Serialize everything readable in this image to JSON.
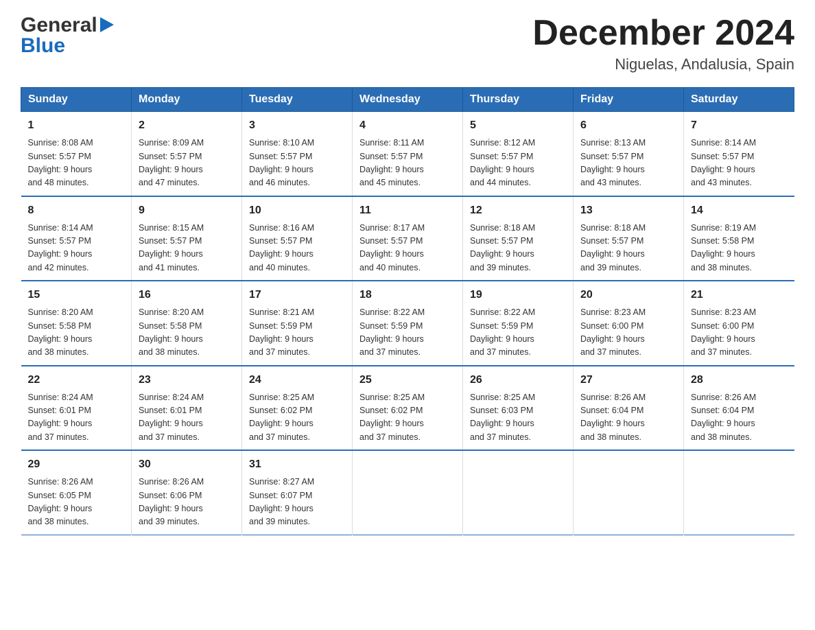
{
  "header": {
    "logo_general": "General",
    "logo_blue": "Blue",
    "month_title": "December 2024",
    "location": "Niguelas, Andalusia, Spain"
  },
  "columns": [
    "Sunday",
    "Monday",
    "Tuesday",
    "Wednesday",
    "Thursday",
    "Friday",
    "Saturday"
  ],
  "weeks": [
    [
      {
        "day": "1",
        "sunrise": "8:08 AM",
        "sunset": "5:57 PM",
        "daylight": "9 hours and 48 minutes."
      },
      {
        "day": "2",
        "sunrise": "8:09 AM",
        "sunset": "5:57 PM",
        "daylight": "9 hours and 47 minutes."
      },
      {
        "day": "3",
        "sunrise": "8:10 AM",
        "sunset": "5:57 PM",
        "daylight": "9 hours and 46 minutes."
      },
      {
        "day": "4",
        "sunrise": "8:11 AM",
        "sunset": "5:57 PM",
        "daylight": "9 hours and 45 minutes."
      },
      {
        "day": "5",
        "sunrise": "8:12 AM",
        "sunset": "5:57 PM",
        "daylight": "9 hours and 44 minutes."
      },
      {
        "day": "6",
        "sunrise": "8:13 AM",
        "sunset": "5:57 PM",
        "daylight": "9 hours and 43 minutes."
      },
      {
        "day": "7",
        "sunrise": "8:14 AM",
        "sunset": "5:57 PM",
        "daylight": "9 hours and 43 minutes."
      }
    ],
    [
      {
        "day": "8",
        "sunrise": "8:14 AM",
        "sunset": "5:57 PM",
        "daylight": "9 hours and 42 minutes."
      },
      {
        "day": "9",
        "sunrise": "8:15 AM",
        "sunset": "5:57 PM",
        "daylight": "9 hours and 41 minutes."
      },
      {
        "day": "10",
        "sunrise": "8:16 AM",
        "sunset": "5:57 PM",
        "daylight": "9 hours and 40 minutes."
      },
      {
        "day": "11",
        "sunrise": "8:17 AM",
        "sunset": "5:57 PM",
        "daylight": "9 hours and 40 minutes."
      },
      {
        "day": "12",
        "sunrise": "8:18 AM",
        "sunset": "5:57 PM",
        "daylight": "9 hours and 39 minutes."
      },
      {
        "day": "13",
        "sunrise": "8:18 AM",
        "sunset": "5:57 PM",
        "daylight": "9 hours and 39 minutes."
      },
      {
        "day": "14",
        "sunrise": "8:19 AM",
        "sunset": "5:58 PM",
        "daylight": "9 hours and 38 minutes."
      }
    ],
    [
      {
        "day": "15",
        "sunrise": "8:20 AM",
        "sunset": "5:58 PM",
        "daylight": "9 hours and 38 minutes."
      },
      {
        "day": "16",
        "sunrise": "8:20 AM",
        "sunset": "5:58 PM",
        "daylight": "9 hours and 38 minutes."
      },
      {
        "day": "17",
        "sunrise": "8:21 AM",
        "sunset": "5:59 PM",
        "daylight": "9 hours and 37 minutes."
      },
      {
        "day": "18",
        "sunrise": "8:22 AM",
        "sunset": "5:59 PM",
        "daylight": "9 hours and 37 minutes."
      },
      {
        "day": "19",
        "sunrise": "8:22 AM",
        "sunset": "5:59 PM",
        "daylight": "9 hours and 37 minutes."
      },
      {
        "day": "20",
        "sunrise": "8:23 AM",
        "sunset": "6:00 PM",
        "daylight": "9 hours and 37 minutes."
      },
      {
        "day": "21",
        "sunrise": "8:23 AM",
        "sunset": "6:00 PM",
        "daylight": "9 hours and 37 minutes."
      }
    ],
    [
      {
        "day": "22",
        "sunrise": "8:24 AM",
        "sunset": "6:01 PM",
        "daylight": "9 hours and 37 minutes."
      },
      {
        "day": "23",
        "sunrise": "8:24 AM",
        "sunset": "6:01 PM",
        "daylight": "9 hours and 37 minutes."
      },
      {
        "day": "24",
        "sunrise": "8:25 AM",
        "sunset": "6:02 PM",
        "daylight": "9 hours and 37 minutes."
      },
      {
        "day": "25",
        "sunrise": "8:25 AM",
        "sunset": "6:02 PM",
        "daylight": "9 hours and 37 minutes."
      },
      {
        "day": "26",
        "sunrise": "8:25 AM",
        "sunset": "6:03 PM",
        "daylight": "9 hours and 37 minutes."
      },
      {
        "day": "27",
        "sunrise": "8:26 AM",
        "sunset": "6:04 PM",
        "daylight": "9 hours and 38 minutes."
      },
      {
        "day": "28",
        "sunrise": "8:26 AM",
        "sunset": "6:04 PM",
        "daylight": "9 hours and 38 minutes."
      }
    ],
    [
      {
        "day": "29",
        "sunrise": "8:26 AM",
        "sunset": "6:05 PM",
        "daylight": "9 hours and 38 minutes."
      },
      {
        "day": "30",
        "sunrise": "8:26 AM",
        "sunset": "6:06 PM",
        "daylight": "9 hours and 39 minutes."
      },
      {
        "day": "31",
        "sunrise": "8:27 AM",
        "sunset": "6:07 PM",
        "daylight": "9 hours and 39 minutes."
      },
      null,
      null,
      null,
      null
    ]
  ],
  "labels": {
    "sunrise": "Sunrise:",
    "sunset": "Sunset:",
    "daylight": "Daylight:"
  }
}
